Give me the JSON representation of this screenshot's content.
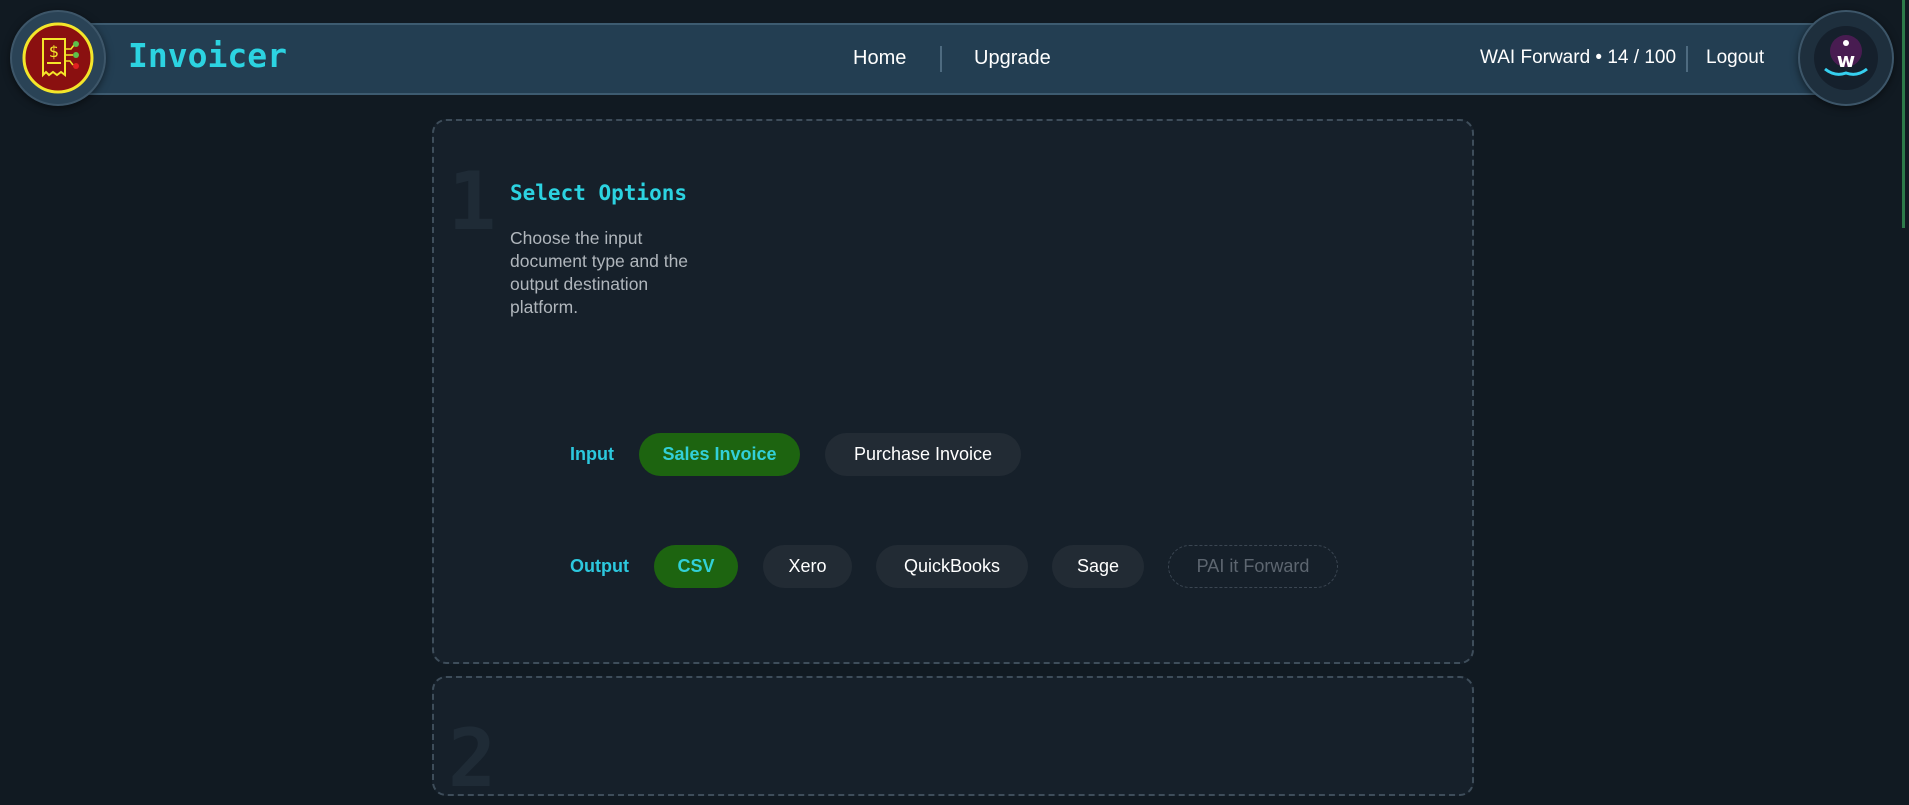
{
  "header": {
    "app_title": "Invoicer",
    "nav": [
      {
        "label": "Home"
      },
      {
        "label": "Upgrade"
      }
    ],
    "user_status": "WAI Forward • 14 / 100",
    "logout_label": "Logout"
  },
  "step1": {
    "number": "1",
    "title": "Select Options",
    "description": "Choose the input document type and the output destination platform.",
    "input": {
      "label": "Input",
      "options": [
        "Sales Invoice",
        "Purchase Invoice"
      ],
      "selected": "Sales Invoice"
    },
    "output": {
      "label": "Output",
      "options": [
        "CSV",
        "Xero",
        "QuickBooks",
        "Sage",
        "PAI it Forward"
      ],
      "selected": "CSV",
      "disabled": [
        "PAI it Forward"
      ]
    }
  },
  "step2": {
    "number": "2"
  },
  "colors": {
    "accent": "#2cd3e1",
    "selected": "#1d6410",
    "header": "#233e52"
  }
}
